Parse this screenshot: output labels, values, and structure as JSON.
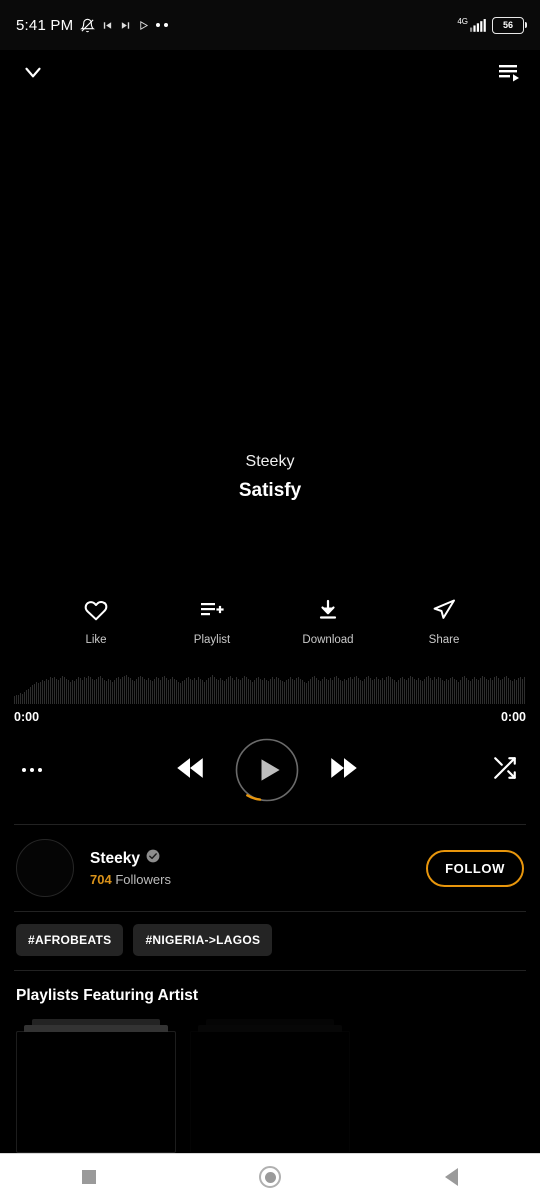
{
  "status_bar": {
    "time": "5:41 PM",
    "battery_level": "56",
    "network": "4G",
    "icons": [
      "bell-muted-icon",
      "media-prev-icon",
      "media-next-icon",
      "media-play-icon",
      "more-icon"
    ]
  },
  "top_nav": {
    "collapse_icon": "chevron-down-icon",
    "queue_icon": "queue-list-icon"
  },
  "now_playing": {
    "artist": "Steeky",
    "title": "Satisfy",
    "elapsed_time": "0:00",
    "total_time": "0:00"
  },
  "actions": [
    {
      "label": "Like",
      "icon": "heart-icon"
    },
    {
      "label": "Playlist",
      "icon": "playlist-add-icon"
    },
    {
      "label": "Download",
      "icon": "download-icon"
    },
    {
      "label": "Share",
      "icon": "share-icon"
    }
  ],
  "transport": {
    "more_icon": "more-horizontal-icon",
    "previous_icon": "skip-previous-icon",
    "play_icon": "play-icon",
    "next_icon": "skip-next-icon",
    "shuffle_icon": "shuffle-icon",
    "progress_accent": "#e8960c",
    "ring_color": "#6b6b6b"
  },
  "artist_card": {
    "name": "Steeky",
    "verified_icon": "verified-badge-icon",
    "follower_count": "704",
    "follower_label": "Followers",
    "follow_button": "FOLLOW",
    "accent": "#e8960c"
  },
  "tags": [
    "#AFROBEATS",
    "#NIGERIA->LAGOS"
  ],
  "playlists_section": {
    "title": "Playlists Featuring Artist"
  },
  "android_nav": {
    "recents": "recents-square-icon",
    "home": "home-circle-icon",
    "back": "back-triangle-icon"
  },
  "waveform": {
    "bars": [
      22,
      24,
      26,
      30,
      28,
      34,
      38,
      42,
      48,
      52,
      56,
      60,
      58,
      62,
      66,
      64,
      70,
      68,
      74,
      72,
      76,
      70,
      66,
      72,
      78,
      74,
      70,
      66,
      62,
      68,
      64,
      70,
      74,
      72,
      68,
      76,
      72,
      78,
      74,
      70,
      66,
      70,
      74,
      78,
      72,
      68,
      64,
      70,
      66,
      62,
      68,
      72,
      76,
      70,
      74,
      78,
      80,
      76,
      72,
      68,
      64,
      70,
      74,
      78,
      74,
      70,
      66,
      72,
      68,
      64,
      70,
      76,
      72,
      68,
      74,
      78,
      72,
      66,
      70,
      74,
      70,
      66,
      62,
      58,
      64,
      68,
      72,
      76,
      70,
      66,
      72,
      68,
      74,
      70,
      66,
      62,
      68,
      72,
      76,
      80,
      74,
      70,
      66,
      72,
      68,
      64,
      70,
      74,
      78,
      72,
      68,
      74,
      70,
      66,
      72,
      78,
      74,
      70,
      66,
      62,
      68,
      72,
      76,
      70,
      66,
      72,
      68,
      64,
      70,
      74,
      70,
      76,
      72,
      68,
      64,
      60,
      66,
      70,
      74,
      70,
      66,
      72,
      76,
      70,
      66,
      62,
      58,
      64,
      70,
      74,
      78,
      72,
      68,
      64,
      70,
      74,
      70,
      66,
      72,
      68,
      74,
      78,
      72,
      68,
      64,
      70,
      66,
      72,
      76,
      70,
      74,
      78,
      72,
      68,
      64,
      70,
      74,
      78,
      72,
      66,
      70,
      74,
      70,
      66,
      72,
      68,
      74,
      78,
      74,
      70,
      66,
      62,
      68,
      72,
      76,
      70,
      66,
      72,
      78,
      74,
      70,
      66,
      72,
      68,
      64,
      70,
      74,
      78,
      72,
      68,
      74,
      70,
      76,
      72,
      68,
      64,
      70,
      66,
      72,
      76,
      70,
      66,
      62,
      68,
      74,
      78,
      72,
      68,
      64,
      70,
      74,
      70,
      66,
      72,
      78,
      74,
      70,
      66,
      72,
      68,
      74,
      78,
      72,
      66,
      70,
      74,
      78,
      72,
      68,
      64,
      70,
      66,
      72,
      76,
      70,
      74,
      78,
      74,
      70,
      66,
      62,
      58
    ]
  }
}
